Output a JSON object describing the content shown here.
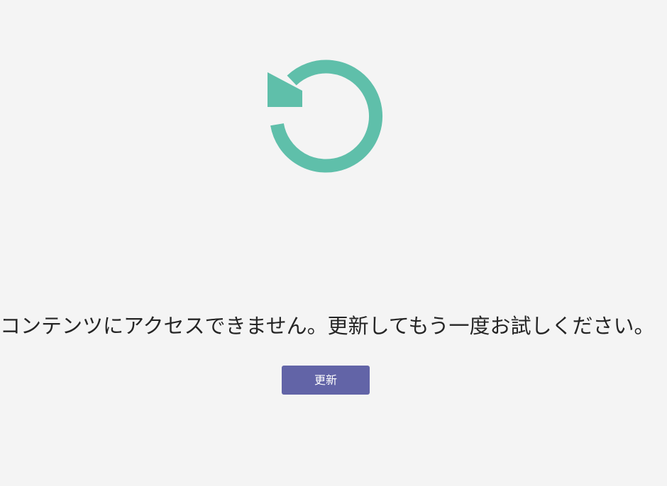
{
  "error_state": {
    "icon": "refresh-arrow-icon",
    "accent_color": "#5fbfaa",
    "message": "コンテンツにアクセスできません。更新してもう一度お試しください。",
    "refresh_button_label": "更新",
    "button_color": "#6264a7"
  }
}
